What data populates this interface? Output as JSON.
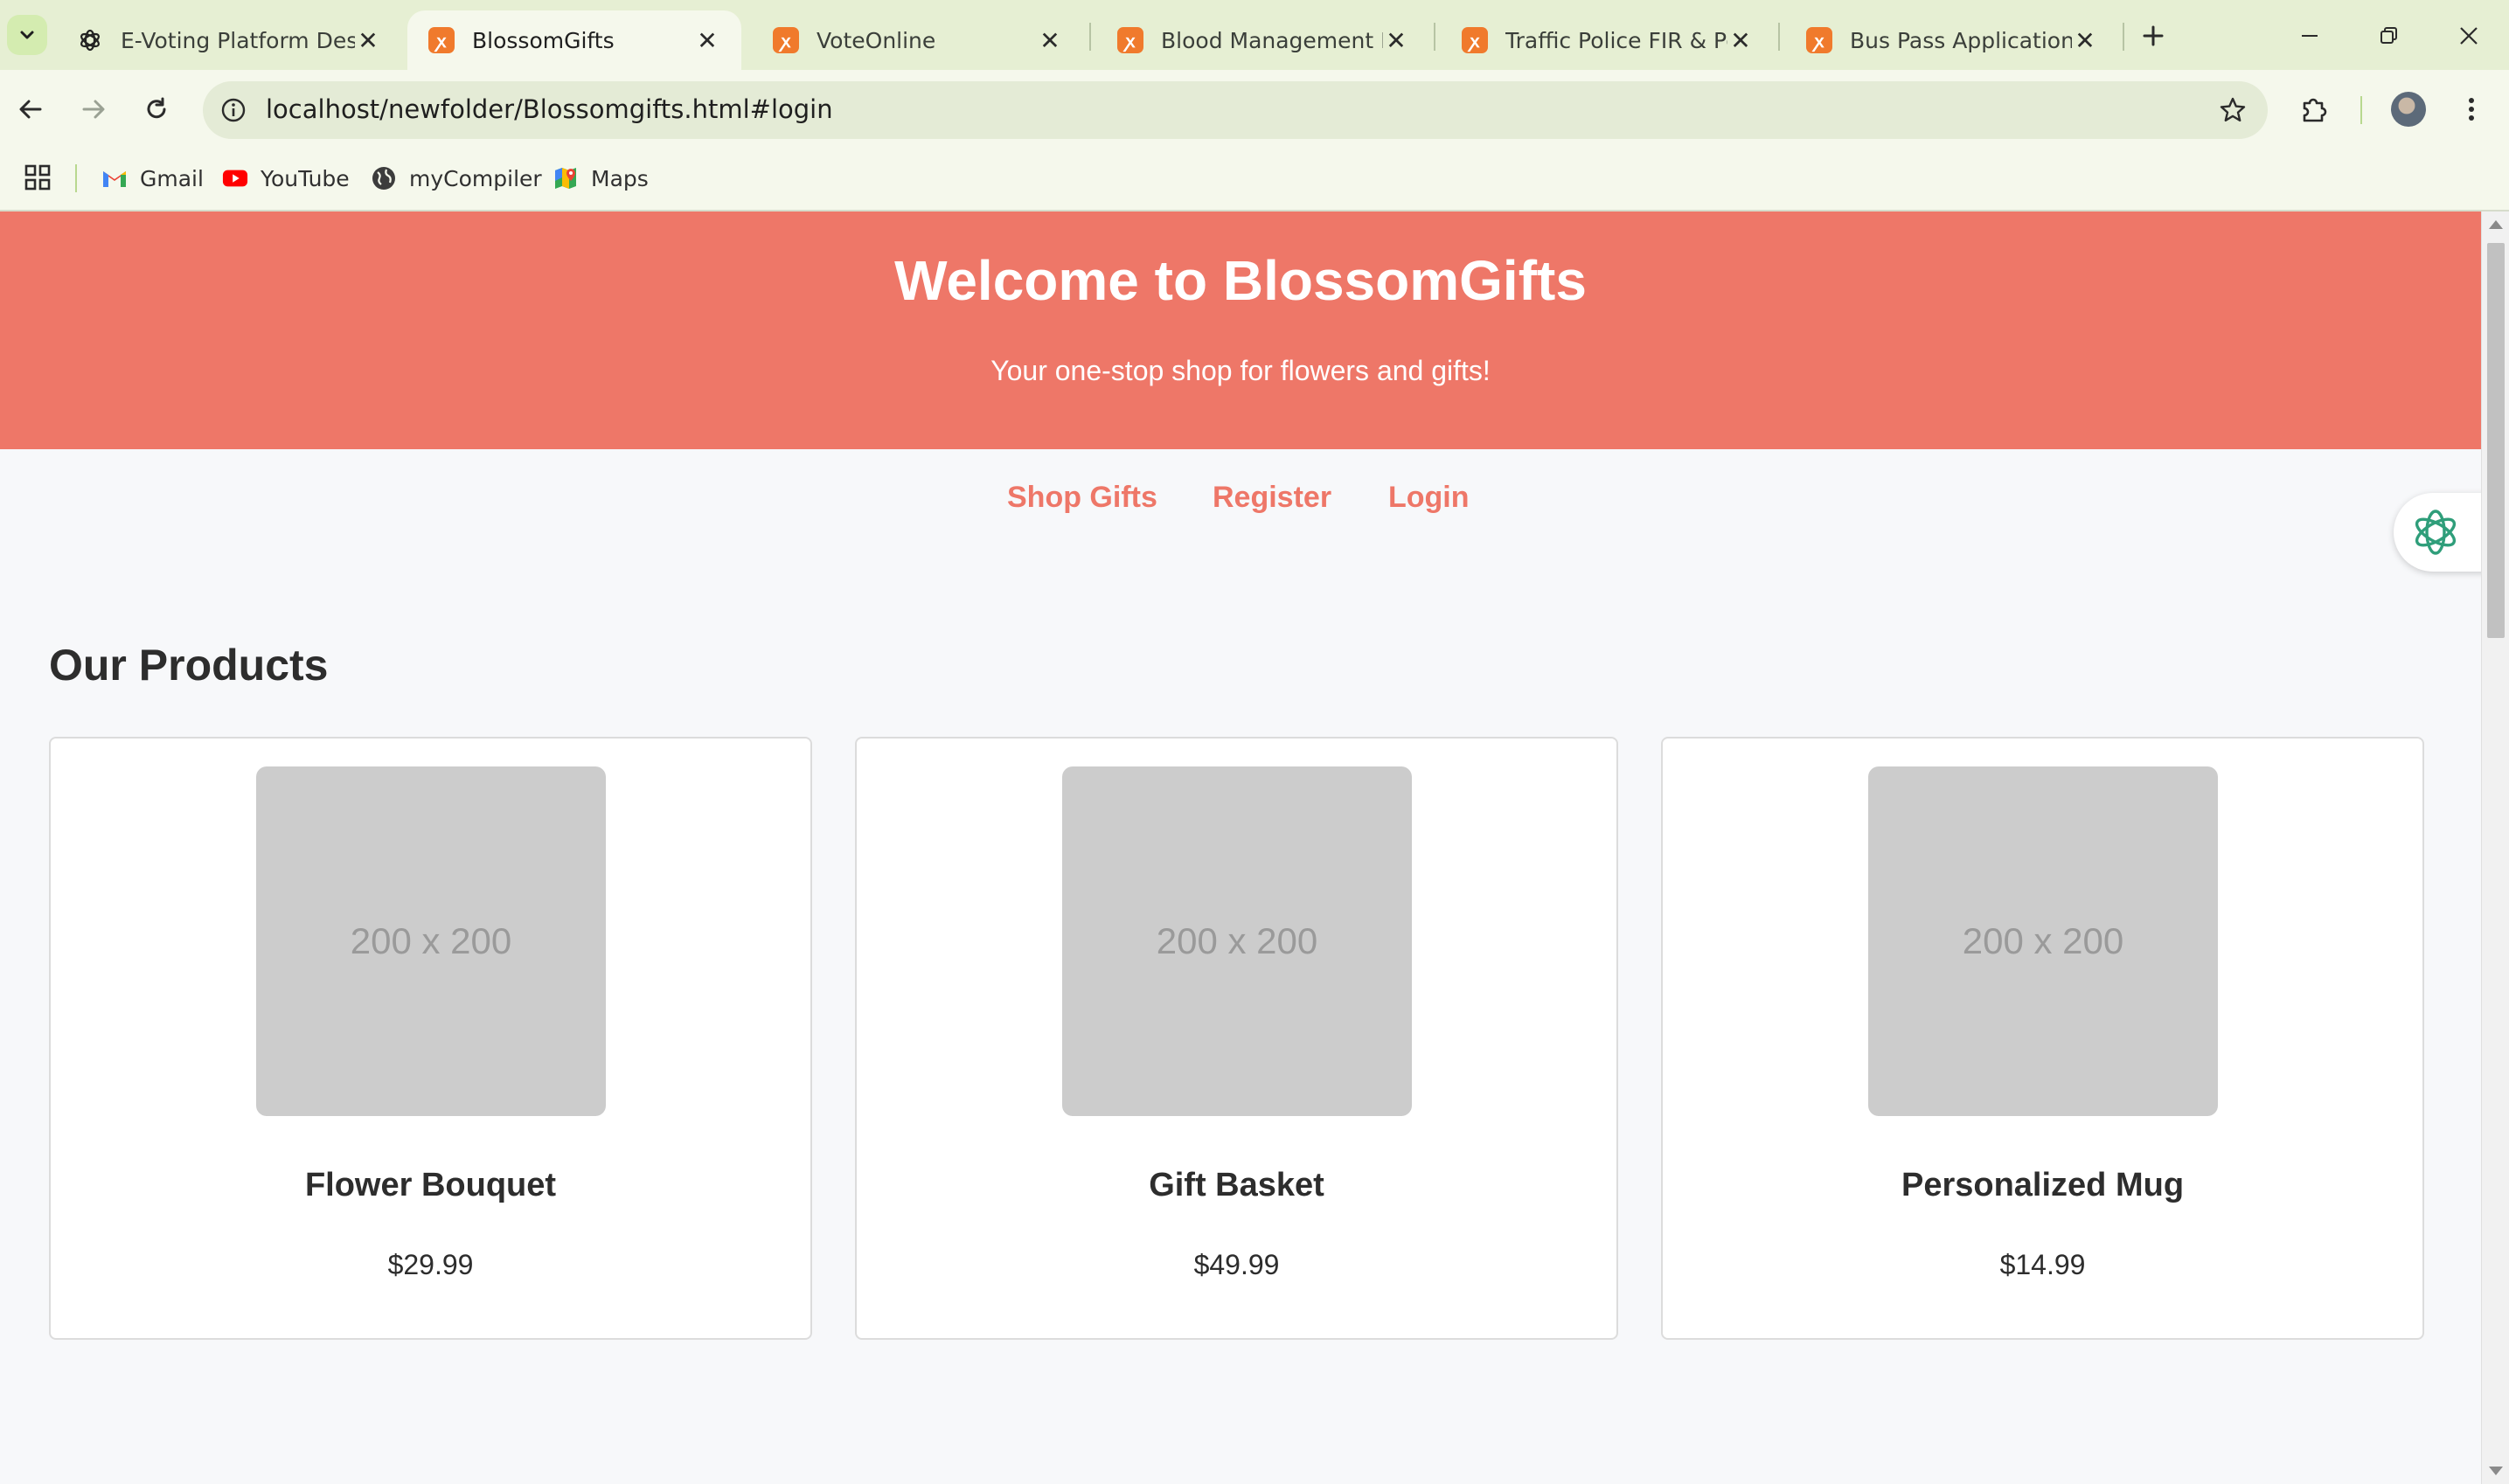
{
  "browser": {
    "tabs": [
      {
        "title": "E-Voting Platform Desig",
        "icon": "chatgpt-icon",
        "active": false
      },
      {
        "title": "BlossomGifts",
        "icon": "xampp-icon",
        "active": true
      },
      {
        "title": "VoteOnline",
        "icon": "xampp-icon",
        "active": false
      },
      {
        "title": "Blood Management Info",
        "icon": "xampp-icon",
        "active": false
      },
      {
        "title": "Traffic Police FIR & Pena",
        "icon": "xampp-icon",
        "active": false
      },
      {
        "title": "Bus Pass Application Sy",
        "icon": "xampp-icon",
        "active": false
      }
    ],
    "url": "localhost/newfolder/Blossomgifts.html#login",
    "bookmarks": [
      {
        "label": "Gmail",
        "icon": "gmail-icon"
      },
      {
        "label": "YouTube",
        "icon": "youtube-icon"
      },
      {
        "label": "myCompiler",
        "icon": "globe-icon"
      },
      {
        "label": "Maps",
        "icon": "maps-icon"
      }
    ],
    "colors": {
      "tabstrip": "#e6efd3",
      "toolbar": "#f5f8ec",
      "omnibox": "#e4ebd6"
    }
  },
  "site": {
    "hero": {
      "title": "Welcome to BlossomGifts",
      "subtitle": "Your one-stop shop for flowers and gifts!"
    },
    "nav": [
      {
        "label": "Shop Gifts"
      },
      {
        "label": "Register"
      },
      {
        "label": "Login"
      }
    ],
    "products_title": "Our Products",
    "products": [
      {
        "placeholder": "200 x 200",
        "name": "Flower Bouquet",
        "price": "$29.99"
      },
      {
        "placeholder": "200 x 200",
        "name": "Gift Basket",
        "price": "$49.99"
      },
      {
        "placeholder": "200 x 200",
        "name": "Personalized Mug",
        "price": "$14.99"
      }
    ],
    "colors": {
      "accent": "#ee7768",
      "background": "#f7f8fa",
      "text": "#2d2d2d"
    }
  }
}
